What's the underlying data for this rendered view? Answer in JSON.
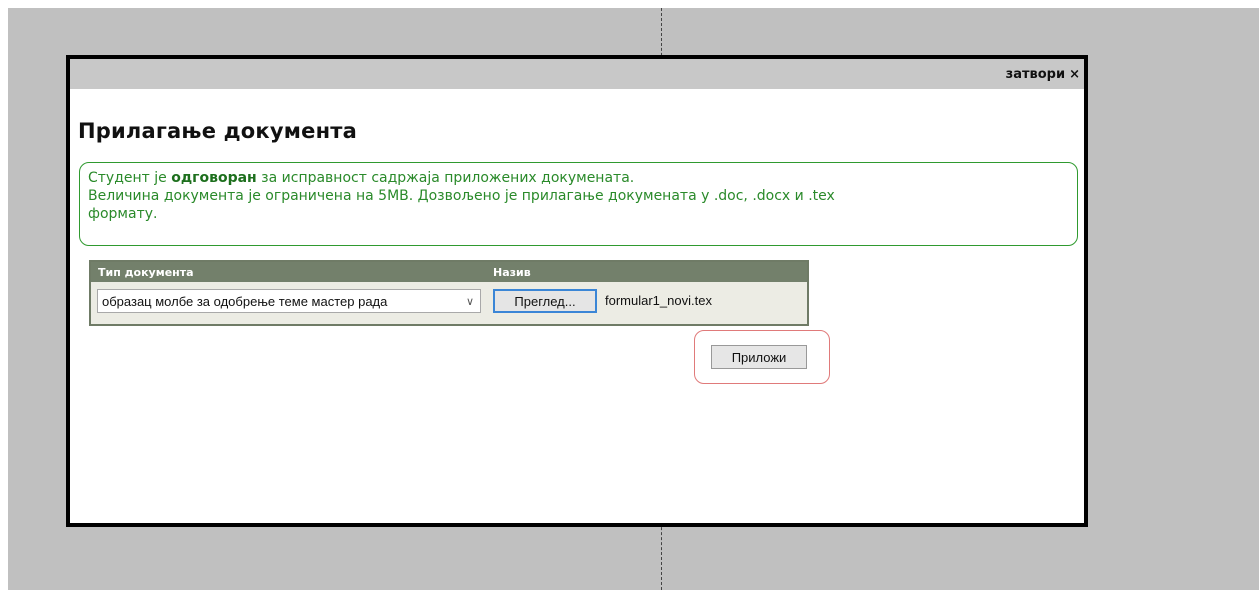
{
  "modal": {
    "close_label": "затвори",
    "close_symbol": "×",
    "title": "Прилагање документа"
  },
  "notice": {
    "line1_prefix": "Студент је ",
    "line1_bold": "одговоран",
    "line1_suffix": " за исправност садржаја приложених докумената.",
    "line2": "Величина документа је ограничена на 5MB. Дозвољено је прилагање докумената у .doc, .docx и .tex",
    "line3": "формату."
  },
  "document_table": {
    "header_type": "Тип документа",
    "header_name": "Назив",
    "selected_type": "образац молбе за одобрење теме мастер рада",
    "browse_label": "Преглед...",
    "file_name": "formular1_novi.tex"
  },
  "actions": {
    "attach_label": "Приложи"
  },
  "colors": {
    "backdrop": "#c0c0c0",
    "notice_green": "#2a8a2a",
    "table_header": "#73806b",
    "highlight": "#e07a7a",
    "browse_border": "#3b86d6"
  }
}
